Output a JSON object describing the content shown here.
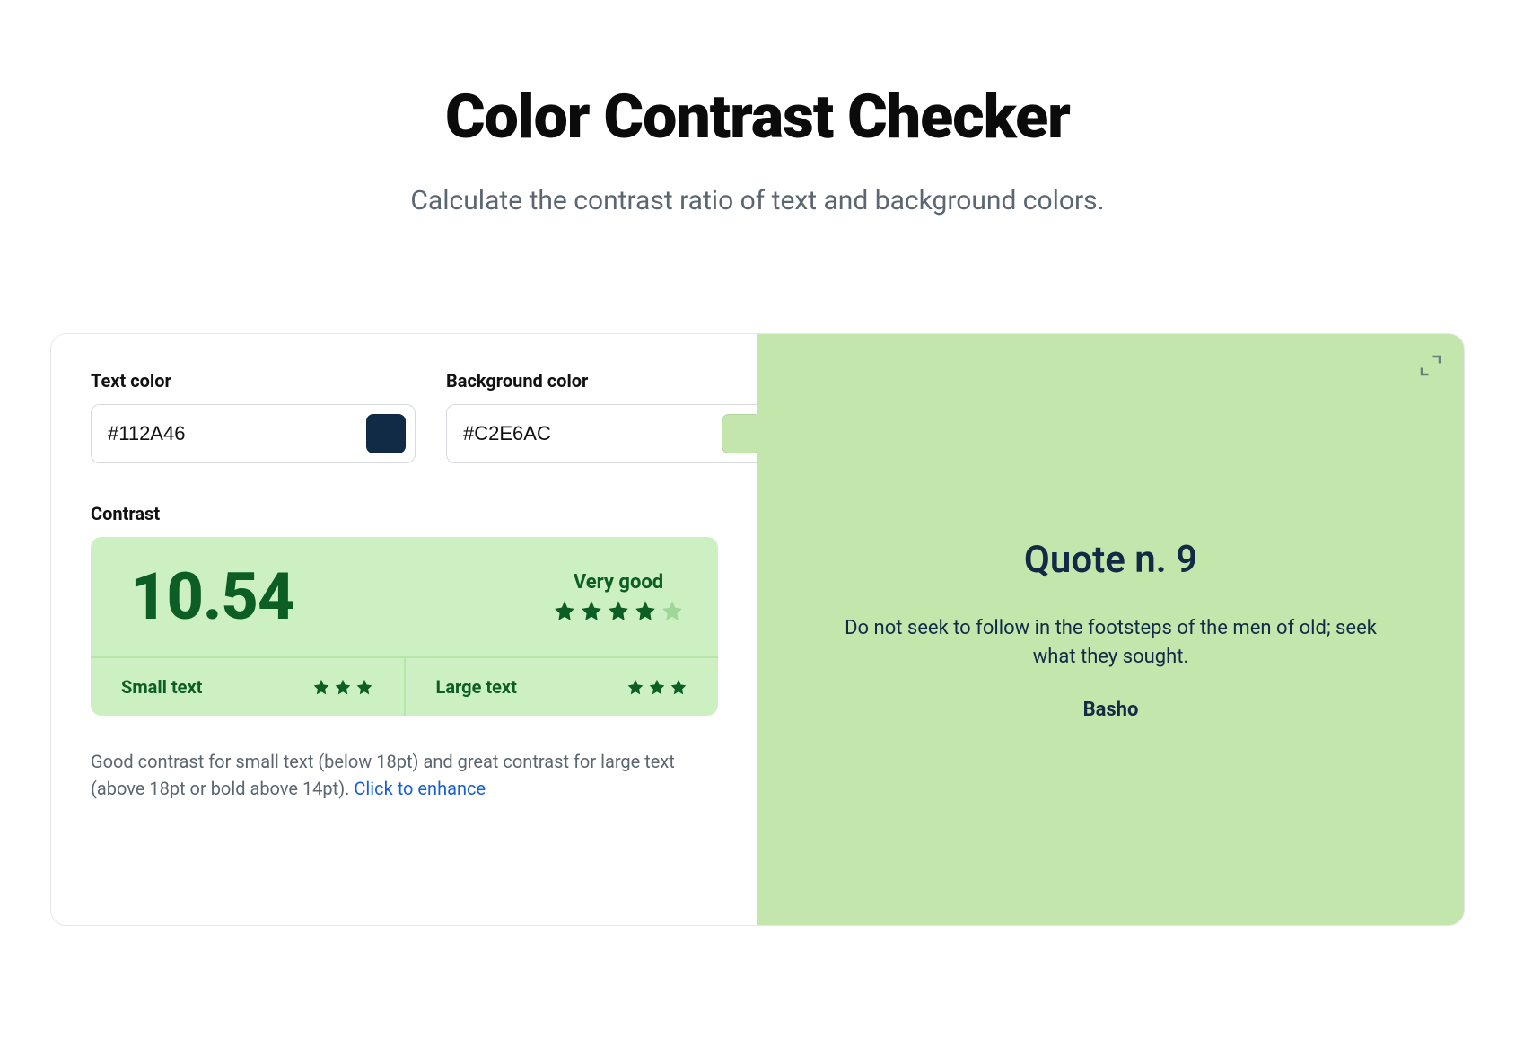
{
  "header": {
    "title": "Color Contrast Checker",
    "subtitle": "Calculate the contrast ratio of text and background colors."
  },
  "fields": {
    "text_color": {
      "label": "Text color",
      "value": "#112A46",
      "swatch": "#112A46"
    },
    "background_color": {
      "label": "Background color",
      "value": "#C2E6AC",
      "swatch": "#C2E6AC"
    }
  },
  "contrast": {
    "section_label": "Contrast",
    "value": "10.54",
    "rating_label": "Very good",
    "rating_filled": 4,
    "rating_total": 5,
    "small_text": {
      "label": "Small text",
      "stars": 3
    },
    "large_text": {
      "label": "Large text",
      "stars": 3
    },
    "description": "Good contrast for small text (below 18pt) and great contrast for large text (above 18pt or bold above 14pt). ",
    "enhance_link": "Click to enhance"
  },
  "preview": {
    "bg": "#C2E6AC",
    "fg": "#112A46",
    "title": "Quote n. 9",
    "body": "Do not seek to follow in the footsteps of the men of old; seek what they sought.",
    "author": "Basho"
  }
}
